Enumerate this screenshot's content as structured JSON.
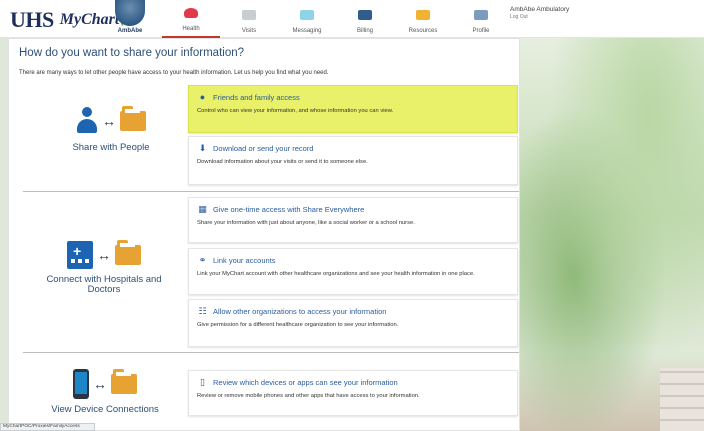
{
  "header": {
    "logo_text": "UHS",
    "logo_sub": "MyChart",
    "avatar_label": "AmbAbe",
    "nav": [
      {
        "label": "Health",
        "icon": "heart-icon"
      },
      {
        "label": "Visits",
        "icon": "calendar-icon"
      },
      {
        "label": "Messaging",
        "icon": "envelope-icon"
      },
      {
        "label": "Billing",
        "icon": "credit-card-icon"
      },
      {
        "label": "Resources",
        "icon": "folder-icon"
      },
      {
        "label": "Profile",
        "icon": "id-card-icon"
      }
    ],
    "user_name": "AmbAbe Ambulatory",
    "logout_label": "Log Out"
  },
  "main": {
    "title": "How do you want to share your information?",
    "description": "There are many ways to let other people have access to your health information. Let us help you find what you need.",
    "sections": [
      {
        "label": "Share with People"
      },
      {
        "label": "Connect with Hospitals and Doctors"
      },
      {
        "label": "View Device Connections"
      }
    ],
    "cards": [
      {
        "title": "Friends and family access",
        "desc": "Control who can view your information, and whose information you can view.",
        "icon": "people-icon",
        "highlighted": true
      },
      {
        "title": "Download or send your record",
        "desc": "Download information about your visits or send it to someone else.",
        "icon": "download-icon"
      },
      {
        "title": "Give one-time access with Share Everywhere",
        "desc": "Share your information with just about anyone, like a social worker or a school nurse.",
        "icon": "share-everywhere-icon"
      },
      {
        "title": "Link your accounts",
        "desc": "Link your MyChart account with other healthcare organizations and see your health information in one place.",
        "icon": "link-icon"
      },
      {
        "title": "Allow other organizations to access your information",
        "desc": "Give permission for a different healthcare organization to see your information.",
        "icon": "org-chart-icon"
      },
      {
        "title": "Review which devices or apps can see your information",
        "desc": "Review or remove mobile phones and other apps that have access to your information.",
        "icon": "device-icon"
      }
    ]
  },
  "status_bar": {
    "url": "MyChartPOC/Proxies/FamilyAccess"
  },
  "colors": {
    "accent": "#2d4f78",
    "link": "#2a5d9f",
    "highlight": "#e9f06a",
    "folder": "#e6a233",
    "icon_blue": "#1d64b3"
  }
}
